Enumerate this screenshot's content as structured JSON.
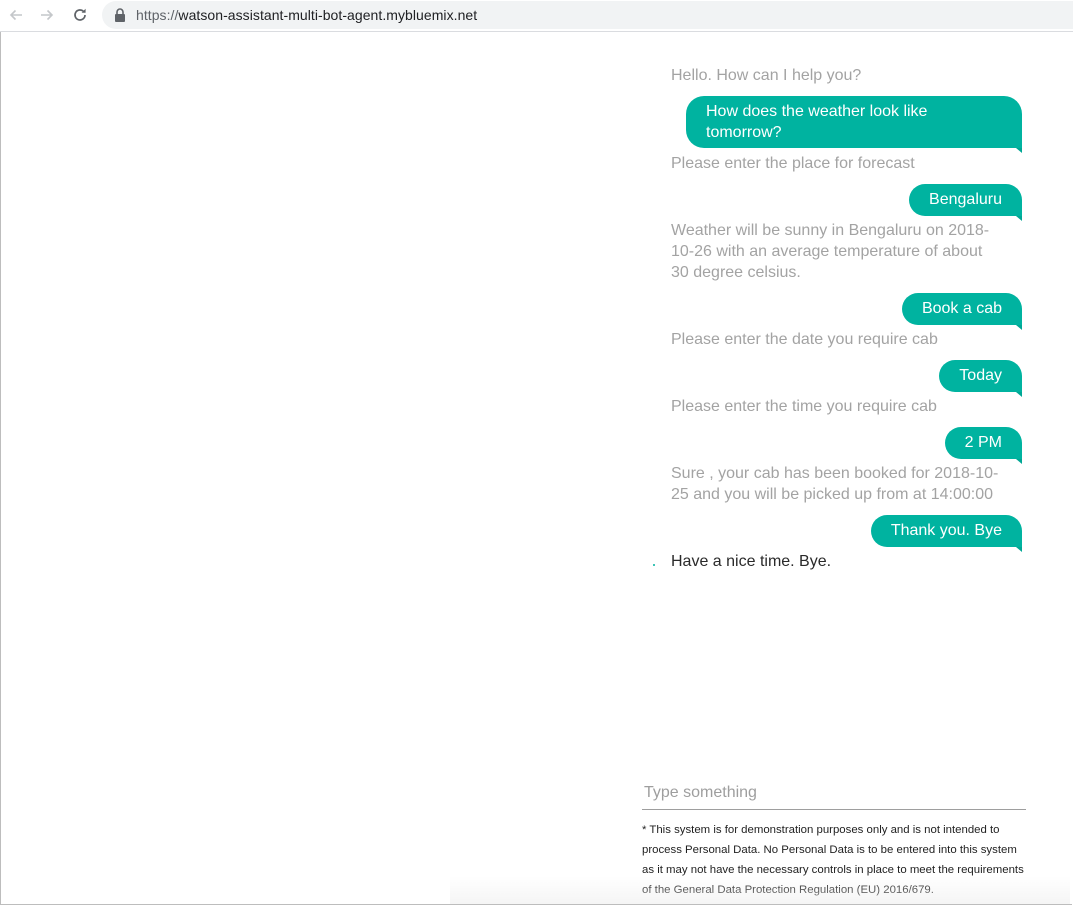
{
  "browser": {
    "url_scheme": "https://",
    "url_host": "watson-assistant-multi-bot-agent.mybluemix.net",
    "icons": [
      "back-arrow-icon",
      "forward-arrow-icon",
      "reload-icon",
      "lock-icon"
    ]
  },
  "chat": {
    "colors": {
      "user_bubble": "#00b3a0",
      "bot_text_old": "#a3a3a3",
      "bot_text_latest": "#2a2a2a"
    },
    "messages": [
      {
        "from": "bot",
        "text": "Hello. How can I help you?"
      },
      {
        "from": "user",
        "text": "How does the weather look like tomorrow?"
      },
      {
        "from": "bot",
        "text": "Please enter the place for forecast"
      },
      {
        "from": "user",
        "text": "Bengaluru"
      },
      {
        "from": "bot",
        "text": "Weather will be sunny in Bengaluru on 2018-10-26 with an average temperature of about 30 degree celsius."
      },
      {
        "from": "user",
        "text": "Book a cab"
      },
      {
        "from": "bot",
        "text": "Please enter the date you require cab"
      },
      {
        "from": "user",
        "text": "Today"
      },
      {
        "from": "bot",
        "text": "Please enter the time you require cab"
      },
      {
        "from": "user",
        "text": "2 PM"
      },
      {
        "from": "bot",
        "text": "Sure , your cab has been booked for 2018-10-25 and you will be picked up from at 14:00:00"
      },
      {
        "from": "user",
        "text": "Thank you. Bye"
      },
      {
        "from": "bot",
        "text": "Have a nice time. Bye."
      }
    ],
    "input_placeholder": "Type something",
    "disclaimer": "* This system is for demonstration purposes only and is not intended to process Personal Data. No Personal Data is to be entered into this system as it may not have the necessary controls in place to meet the requirements of the General Data Protection Regulation (EU) 2016/679."
  }
}
